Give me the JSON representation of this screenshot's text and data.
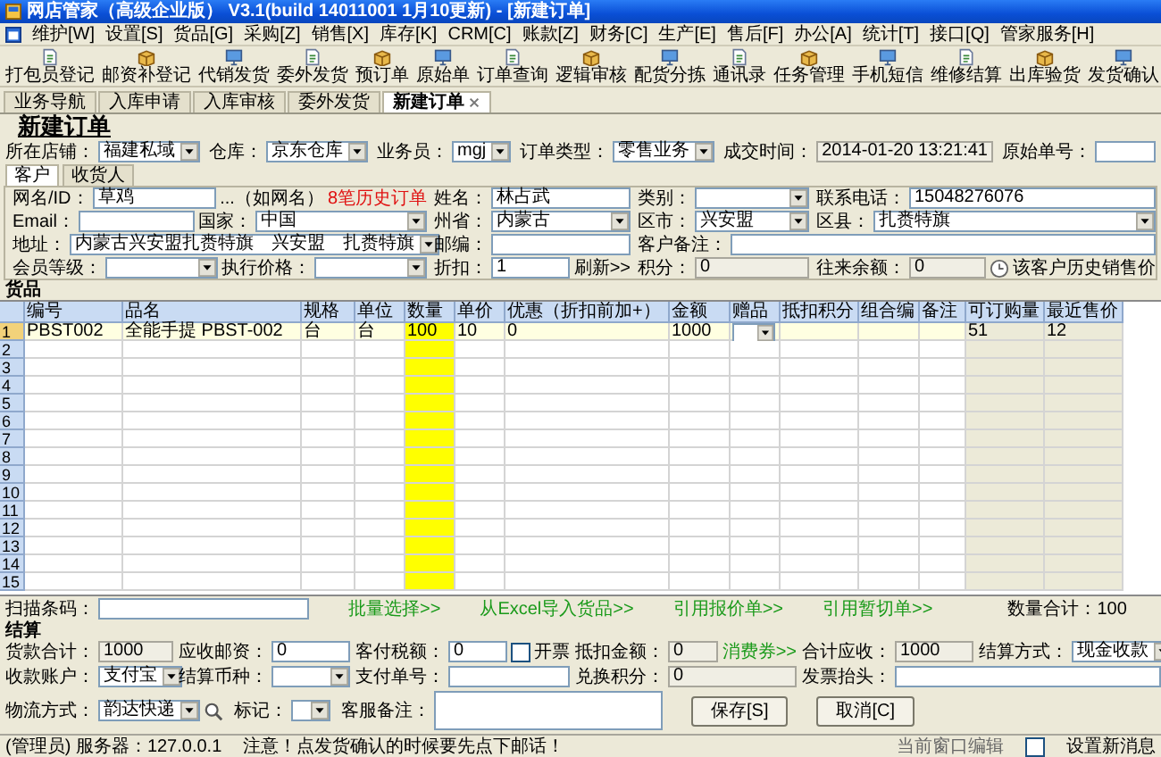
{
  "window": {
    "title": "网店管家（高级企业版） V3.1(build 14011001 1月10更新) - [新建订单]"
  },
  "menu": [
    "维护[W]",
    "设置[S]",
    "货品[G]",
    "采购[Z]",
    "销售[X]",
    "库存[K]",
    "CRM[C]",
    "账款[Z]",
    "财务[C]",
    "生产[E]",
    "售后[F]",
    "办公[A]",
    "统计[T]",
    "接口[Q]",
    "管家服务[H]"
  ],
  "toolbar": [
    {
      "label": "打包员登记"
    },
    {
      "label": "邮资补登记"
    },
    {
      "label": "代销发货"
    },
    {
      "label": "委外发货"
    },
    {
      "label": "预订单"
    },
    {
      "label": "原始单"
    },
    {
      "label": "订单查询"
    },
    {
      "label": "逻辑审核"
    },
    {
      "label": "配货分拣"
    },
    {
      "label": "通讯录"
    },
    {
      "label": "任务管理"
    },
    {
      "label": "手机短信"
    },
    {
      "label": "维修结算"
    },
    {
      "label": "出库验货"
    },
    {
      "label": "发货确认"
    }
  ],
  "tabs": [
    {
      "label": "业务导航",
      "selected": false,
      "closable": false
    },
    {
      "label": "入库申请",
      "selected": false,
      "closable": false
    },
    {
      "label": "入库审核",
      "selected": false,
      "closable": false
    },
    {
      "label": "委外发货",
      "selected": false,
      "closable": false
    },
    {
      "label": "新建订单",
      "selected": true,
      "closable": true
    }
  ],
  "heading": "新建订单",
  "order_fields": [
    {
      "label": "所在店铺：",
      "value": "福建私域",
      "kind": "select"
    },
    {
      "label": "仓库：",
      "value": "京东仓库",
      "kind": "select"
    },
    {
      "label": "业务员：",
      "value": "mgj",
      "kind": "select"
    },
    {
      "label": "订单类型：",
      "value": "零售业务",
      "kind": "select"
    },
    {
      "label": "成交时间：",
      "value": "2014-01-20 13:21:41",
      "kind": "readonly"
    },
    {
      "label": "原始单号：",
      "kind": "text"
    }
  ],
  "customer_tabs": [
    {
      "label": "客户",
      "selected": true
    },
    {
      "label": "收货人",
      "selected": false
    }
  ],
  "customer_rows": [
    [
      [
        {
          "label": "网名/ID：",
          "value": "草鸡",
          "kind": "text"
        },
        {
          "text": "...（如网名）",
          "kind": "plainlink"
        },
        {
          "text": "8笔历史订单",
          "kind": "alert"
        }
      ],
      [
        {
          "label": "姓名：",
          "value": "林占武",
          "kind": "text"
        }
      ],
      [
        {
          "label": "类别：",
          "kind": "select"
        }
      ],
      [
        {
          "label": "联系电话：",
          "value": "15048276076",
          "kind": "text"
        }
      ]
    ],
    [
      [
        {
          "label": "Email：",
          "kind": "text"
        },
        {
          "label": "国家：",
          "value": "中国",
          "kind": "select"
        }
      ],
      [
        {
          "label": "州省：",
          "value": "内蒙古",
          "kind": "select"
        }
      ],
      [
        {
          "label": "区市：",
          "value": "兴安盟",
          "kind": "select"
        }
      ],
      [
        {
          "label": "区县：",
          "value": "扎赉特旗",
          "kind": "select"
        }
      ]
    ],
    [
      [
        {
          "label": "地址：",
          "value": "内蒙古兴安盟扎赉特旗　兴安盟　扎赉特旗",
          "kind": "select"
        }
      ],
      [
        {
          "label": "邮编：",
          "kind": "text"
        }
      ],
      [
        {
          "label": "客户备注：",
          "kind": "text"
        }
      ]
    ],
    [
      [
        {
          "label": "会员等级：",
          "kind": "select"
        },
        {
          "label": "执行价格：",
          "kind": "select"
        }
      ],
      [
        {
          "label": "折扣：",
          "value": "1",
          "kind": "text"
        },
        {
          "text": "刷新>>",
          "kind": "plainlink"
        }
      ],
      [
        {
          "label": "积分：",
          "value": "0",
          "kind": "readonly"
        }
      ],
      [
        {
          "label": "往来余额：",
          "value": "0",
          "kind": "readonly"
        },
        {
          "text": "该客户历史销售价",
          "kind": "iconlink"
        }
      ]
    ]
  ],
  "goods_label": "货品",
  "goods_table": {
    "columns": [
      {
        "label": "编号",
        "kind": "normal"
      },
      {
        "label": "品名",
        "kind": "normal"
      },
      {
        "label": "规格",
        "kind": "normal"
      },
      {
        "label": "单位",
        "kind": "normal"
      },
      {
        "label": "数量",
        "kind": "highlight"
      },
      {
        "label": "单价",
        "kind": "normal"
      },
      {
        "label": "优惠（折扣前加+）",
        "kind": "normal"
      },
      {
        "label": "金额",
        "kind": "normal"
      },
      {
        "label": "赠品",
        "kind": "select"
      },
      {
        "label": "抵扣积分",
        "kind": "normal"
      },
      {
        "label": "组合编",
        "kind": "normal"
      },
      {
        "label": "备注",
        "kind": "normal"
      },
      {
        "label": "可订购量",
        "kind": "readonly"
      },
      {
        "label": "最近售价",
        "kind": "readonly"
      }
    ],
    "rows": [
      {
        "no": "1",
        "selected": true,
        "code": "PBST002",
        "name": "全能手提 PBST-002",
        "spec": "台",
        "unit": "台",
        "qty": "100",
        "price": "10",
        "discount": "0",
        "amount": "1000",
        "available": "51",
        "last_price": "12"
      },
      {
        "no": "2",
        "selected": false
      },
      {
        "no": "3",
        "selected": false
      },
      {
        "no": "4",
        "selected": false
      },
      {
        "no": "5",
        "selected": false
      },
      {
        "no": "6",
        "selected": false
      },
      {
        "no": "7",
        "selected": false
      },
      {
        "no": "8",
        "selected": false
      },
      {
        "no": "9",
        "selected": false
      },
      {
        "no": "10",
        "selected": false
      },
      {
        "no": "11",
        "selected": false
      },
      {
        "no": "12",
        "selected": false
      },
      {
        "no": "13",
        "selected": false
      },
      {
        "no": "14",
        "selected": false
      },
      {
        "no": "15",
        "selected": false
      }
    ]
  },
  "scan": {
    "field": {
      "label": "扫描条码：",
      "kind": "text"
    },
    "links": [
      "批量选择>>",
      "从Excel导入货品>>",
      "引用报价单>>",
      "引用暂切单>>"
    ],
    "total": "数量合计：100"
  },
  "settlement": {
    "label": "结算",
    "rows": [
      [
        [
          {
            "label": "货款合计：",
            "value": "1000",
            "kind": "readonly"
          }
        ],
        [
          {
            "label": "应收邮资：",
            "value": "0",
            "kind": "text"
          }
        ],
        [
          {
            "label": "客付税额：",
            "value": "0",
            "kind": "text"
          },
          {
            "label": "开票",
            "kind": "check",
            "checked": false
          }
        ],
        [
          {
            "label": "抵扣金额：",
            "value": "0",
            "kind": "readonly"
          },
          {
            "text": "消费券>>",
            "kind": "link"
          }
        ],
        [
          {
            "label": "合计应收：",
            "value": "1000",
            "kind": "readonly"
          }
        ],
        [
          {
            "label": "结算方式：",
            "value": "现金收款",
            "kind": "select"
          }
        ]
      ],
      [
        [
          {
            "label": "收款账户：",
            "value": "支付宝",
            "kind": "select"
          }
        ],
        [
          {
            "label": "结算币种：",
            "kind": "select"
          }
        ],
        [
          {
            "label": "支付单号：",
            "kind": "text"
          }
        ],
        [
          {
            "label": "兑换积分：",
            "value": "0",
            "kind": "readonly"
          }
        ],
        [
          {
            "label": "发票抬头：",
            "kind": "text"
          }
        ]
      ]
    ],
    "footer": [
      {
        "label": "物流方式：",
        "value": "韵达快递",
        "kind": "select",
        "icon": true
      },
      {
        "label": "标记：",
        "kind": "select"
      },
      {
        "label": "客服备注：",
        "kind": "textarea"
      },
      {
        "text": "保存[S]",
        "kind": "button"
      },
      {
        "text": "取消[C]",
        "kind": "button"
      }
    ]
  },
  "status_bar": {
    "user": "(管理员) 服务器：127.0.0.1",
    "notice": "注意！点发货确认的时候要先点下邮话！",
    "hint": "当前窗口编辑",
    "option": {
      "label": "设置新消息",
      "checked": false
    }
  }
}
